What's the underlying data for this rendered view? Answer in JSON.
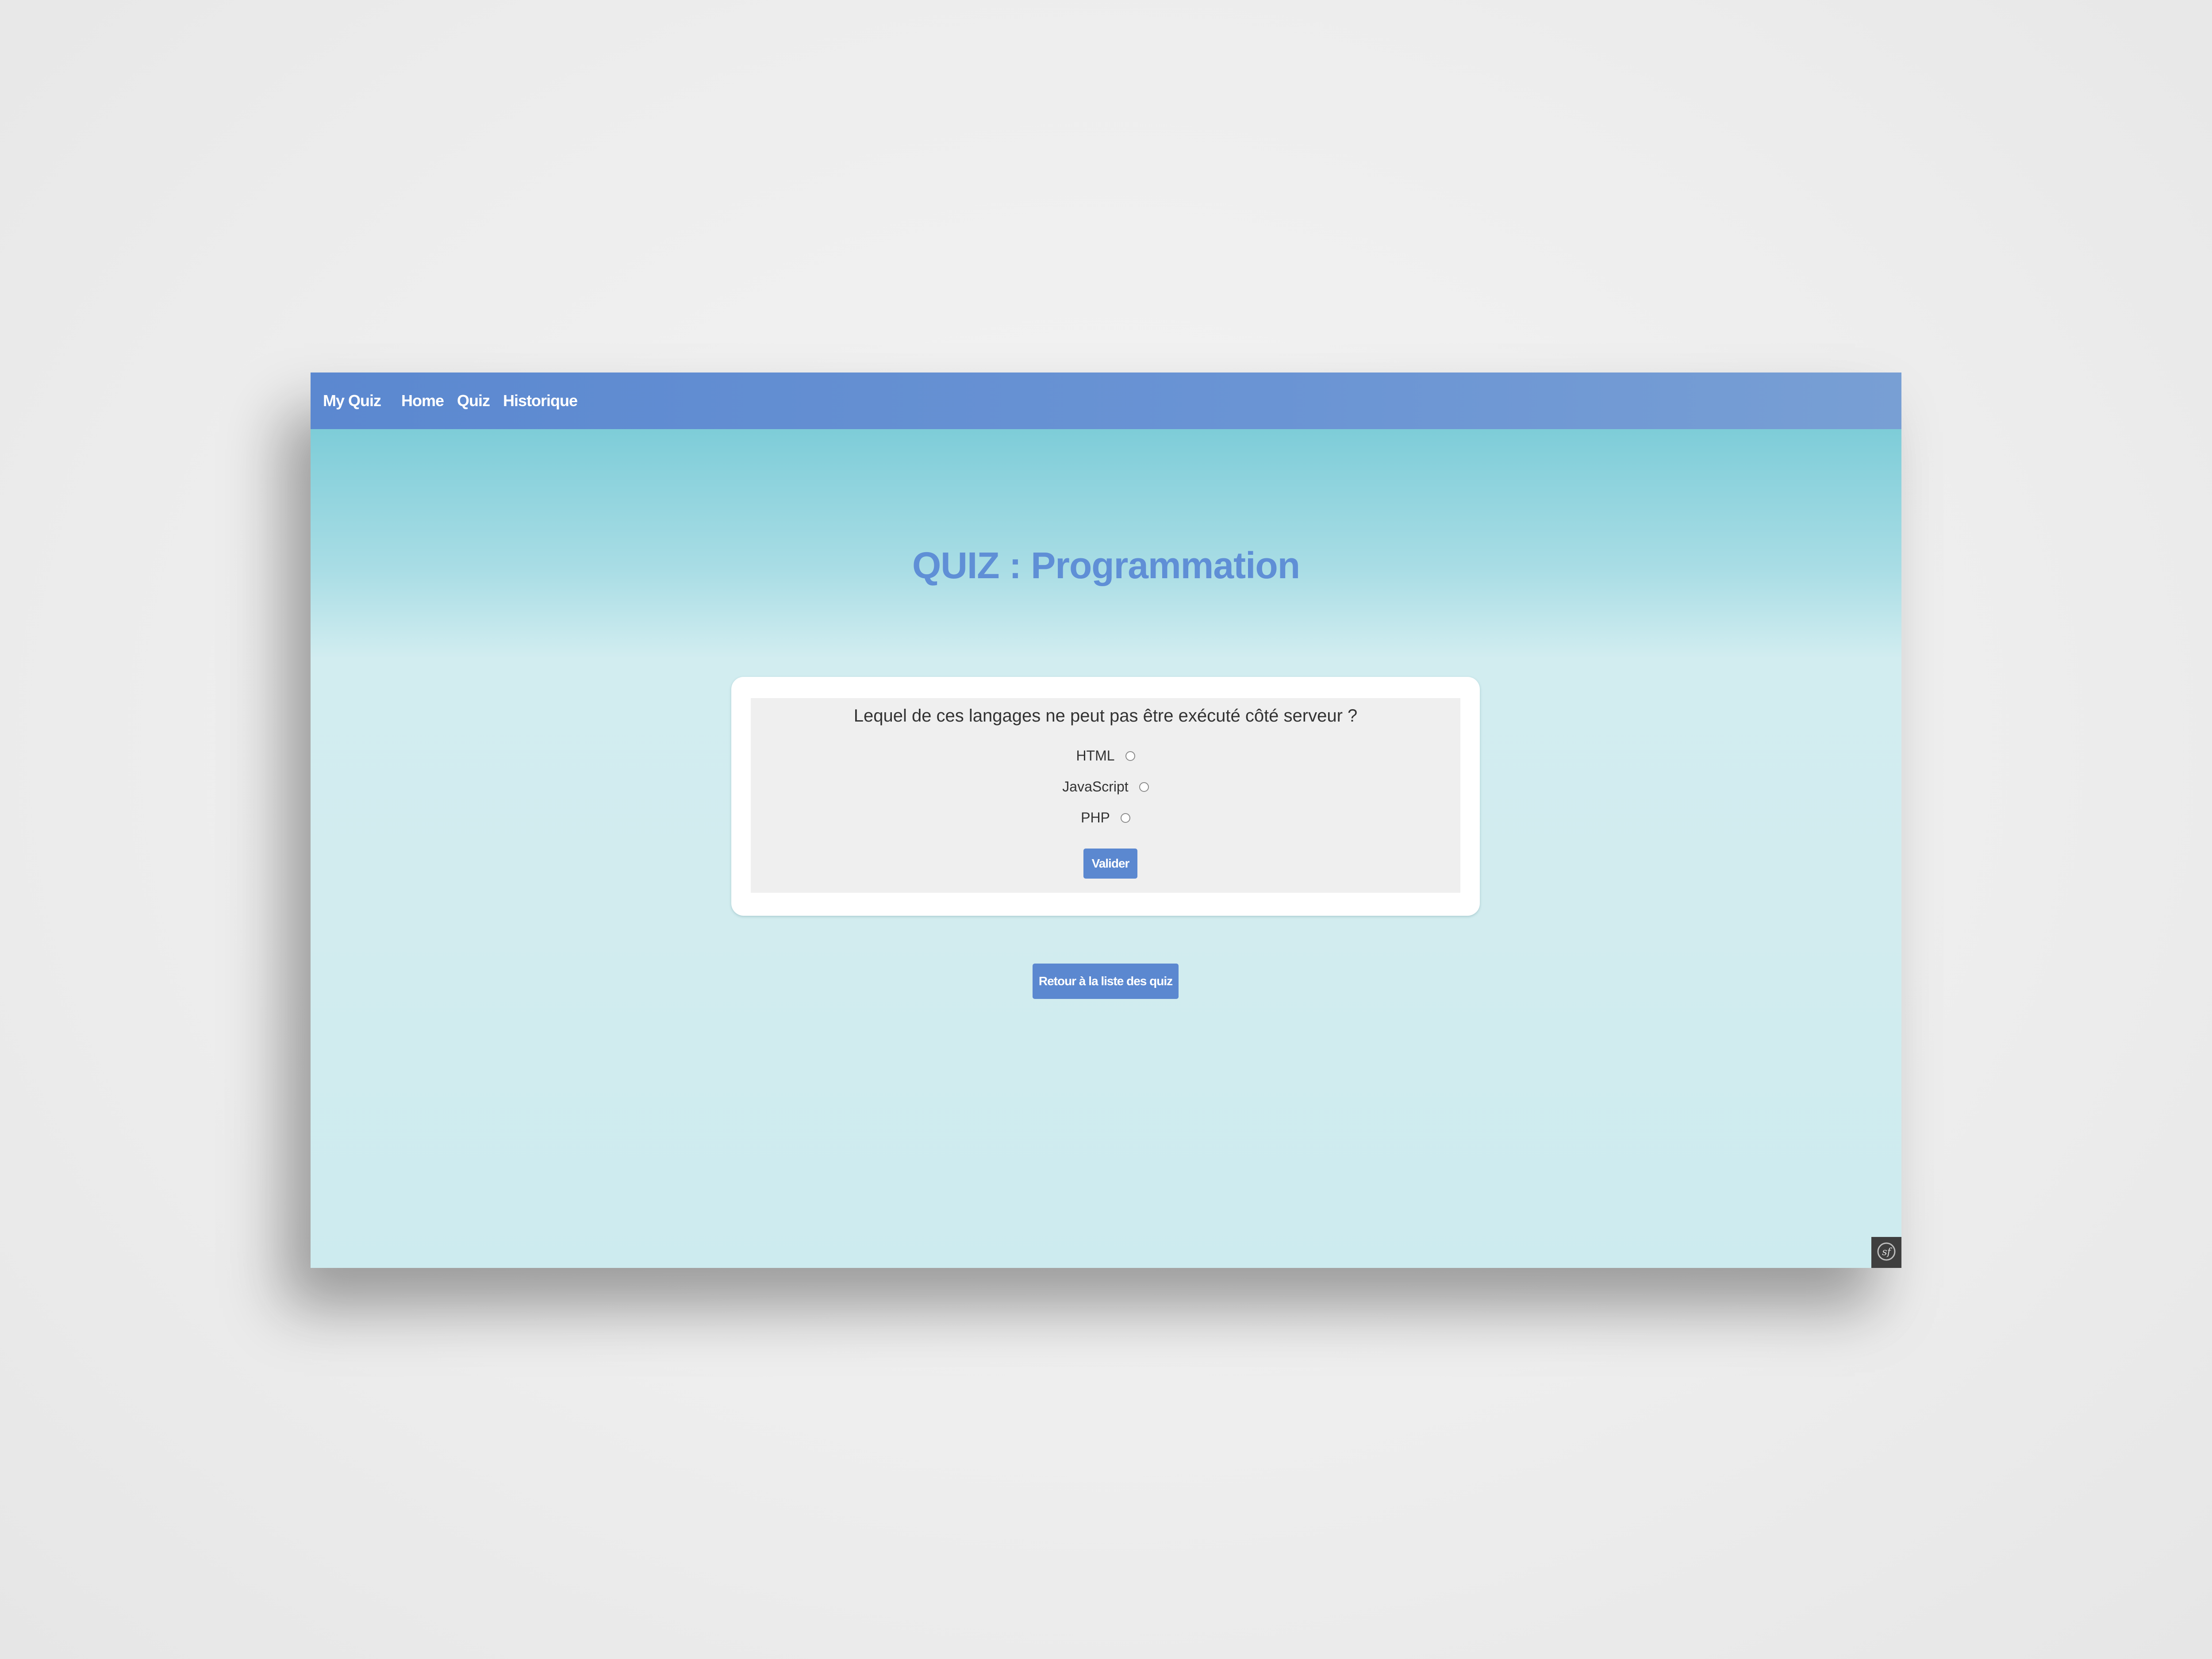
{
  "navbar": {
    "brand": "My Quiz",
    "links": [
      "Home",
      "Quiz",
      "Historique"
    ]
  },
  "page": {
    "title": "QUIZ : Programmation"
  },
  "question": {
    "text": "Lequel de ces langages ne peut pas être exécuté côté serveur ?",
    "options": [
      "HTML",
      "JavaScript",
      "PHP"
    ],
    "validate_label": "Valider"
  },
  "footer": {
    "back_label": "Retour à la liste des quiz"
  },
  "icons": {
    "toolbar": "symfony-icon"
  },
  "colors": {
    "accent": "#5b88d0",
    "title": "#5f8fd6",
    "background_top": "#6cc6d3",
    "background_bottom": "#cdebef"
  }
}
